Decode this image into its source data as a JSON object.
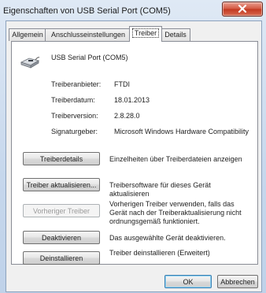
{
  "window": {
    "title": "Eigenschaften von USB Serial Port (COM5)",
    "close_glyph": "✕"
  },
  "tabs": [
    {
      "label": "Allgemein",
      "active": false
    },
    {
      "label": "Anschlusseinstellungen",
      "active": false
    },
    {
      "label": "Treiber",
      "active": true
    },
    {
      "label": "Details",
      "active": false
    }
  ],
  "device": {
    "icon": "usb-connector-icon",
    "name": "USB Serial Port (COM5)"
  },
  "driver_info": [
    {
      "label": "Treiberanbieter:",
      "value": "FTDI"
    },
    {
      "label": "Treiberdatum:",
      "value": "18.01.2013"
    },
    {
      "label": "Treiberversion:",
      "value": "2.8.28.0"
    },
    {
      "label": "Signaturgeber:",
      "value": "Microsoft Windows Hardware Compatibility"
    }
  ],
  "actions": [
    {
      "button": "Treiberdetails",
      "description": "Einzelheiten über Treiberdateien anzeigen",
      "enabled": true
    },
    {
      "button": "Treiber aktualisieren...",
      "description": "Treibersoftware für dieses Gerät aktualisieren",
      "enabled": true
    },
    {
      "button": "Vorheriger Treiber",
      "description": "Vorherigen Treiber verwenden, falls das Gerät nach der Treiberaktualisierung nicht ordnungsgemäß funktioniert.",
      "enabled": false
    },
    {
      "button": "Deaktivieren",
      "description": "Das ausgewählte Gerät deaktivieren.",
      "enabled": true
    },
    {
      "button": "Deinstallieren",
      "description": "Treiber deinstallieren (Erweitert)",
      "enabled": true
    }
  ],
  "footer": {
    "ok": "OK",
    "cancel": "Abbrechen"
  }
}
